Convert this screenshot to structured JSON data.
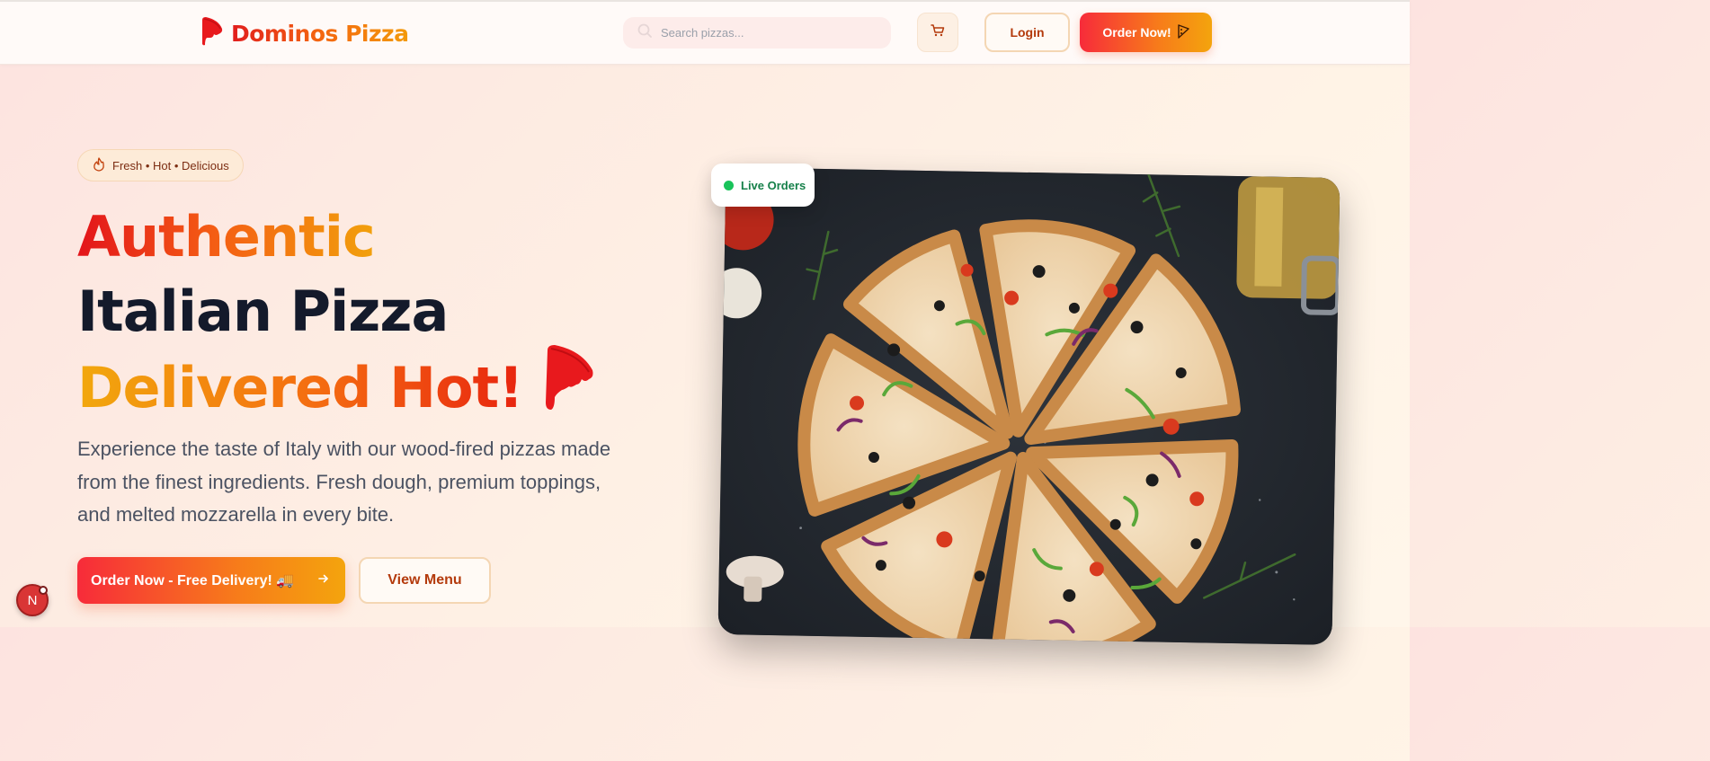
{
  "header": {
    "logo_name": "Dominos Pizza",
    "search_placeholder": "Search pizzas...",
    "login_label": "Login",
    "order_label": "Order Now!"
  },
  "hero": {
    "badge_text": "Fresh • Hot • Delicious",
    "headline_line1": "Authentic",
    "headline_line2": "Italian Pizza",
    "headline_line3": "Delivered Hot!",
    "description": "Experience the taste of Italy with our wood-fired pizzas made from the finest ingredients. Fresh dough, premium toppings, and melted mozzarella in every bite.",
    "cta_primary_label": "Order Now - Free Delivery! 🚚",
    "cta_secondary_label": "View Menu",
    "live_label": "Live Orders"
  },
  "dev_badge_letter": "N",
  "colors": {
    "brand_red": "#e3141b",
    "brand_orange": "#f46b11",
    "brand_amber": "#f2a10c",
    "text_dark": "#141a2b",
    "live_green": "#19c35a"
  },
  "icons": {
    "logo": "pizza-slice-icon",
    "search": "search-icon",
    "cart": "cart-icon",
    "order": "pizza-icon",
    "badge": "flame-icon",
    "cta_arrow": "arrow-right-icon",
    "headline": "pizza-slice-icon"
  }
}
